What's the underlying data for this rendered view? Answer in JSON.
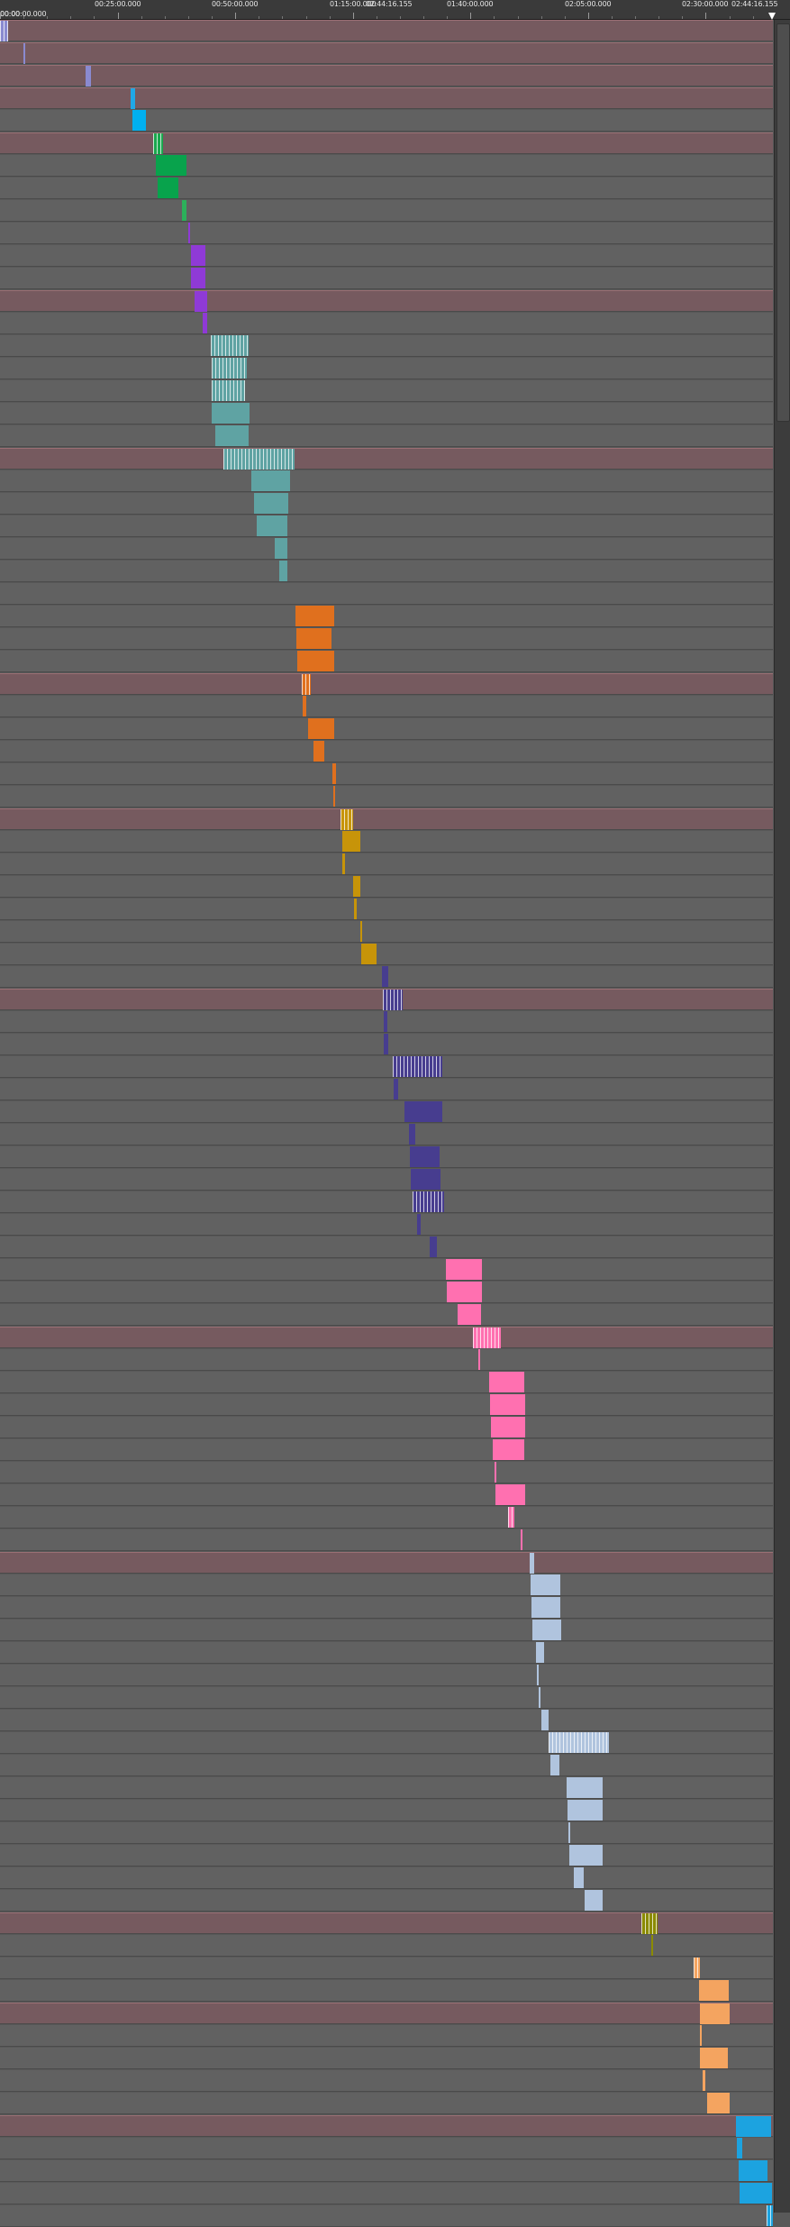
{
  "ruler": {
    "labels": [
      {
        "text": "00:00:00.000",
        "t": 0
      },
      {
        "text": "00:25:00.000",
        "t": 1500
      },
      {
        "text": "00:50:00.000",
        "t": 3000
      },
      {
        "text": "01:15:00.000",
        "t": 4500
      },
      {
        "text": "01:40:00.000",
        "t": 6000
      },
      {
        "text": "02:05:00.000",
        "t": 7500
      },
      {
        "text": "02:30:00.000",
        "t": 9000
      }
    ],
    "start_label": "00:00",
    "playhead_label": "02:44:16.155",
    "end_label": "02:44:16.155",
    "total_seconds": 9856
  },
  "colors": {
    "group_track": "#765a5f",
    "track": "#616161",
    "background": "#595959"
  },
  "tracks": [
    {
      "group": true,
      "clips": [
        {
          "s": 0,
          "e": 100,
          "c": "#8a8ad0",
          "b": true
        }
      ]
    },
    {
      "group": true,
      "clips": [
        {
          "s": 300,
          "e": 305,
          "c": "#8a8ad0"
        }
      ]
    },
    {
      "group": true,
      "clips": [
        {
          "s": 1090,
          "e": 1160,
          "c": "#8a8ad0"
        }
      ]
    },
    {
      "group": true,
      "clips": [
        {
          "s": 1660,
          "e": 1720,
          "c": "#1fa8e6"
        }
      ]
    },
    {
      "group": false,
      "clips": [
        {
          "s": 1690,
          "e": 1860,
          "c": "#00b0f0"
        }
      ]
    },
    {
      "group": true,
      "clips": [
        {
          "s": 1950,
          "e": 2080,
          "c": "#1aa84e",
          "b": true
        }
      ]
    },
    {
      "group": false,
      "clips": [
        {
          "s": 1990,
          "e": 2380,
          "c": "#08a34c"
        }
      ]
    },
    {
      "group": false,
      "clips": [
        {
          "s": 2010,
          "e": 2280,
          "c": "#08a34c"
        }
      ]
    },
    {
      "group": false,
      "clips": [
        {
          "s": 2320,
          "e": 2380,
          "c": "#2cb05a"
        }
      ]
    },
    {
      "group": false,
      "clips": [
        {
          "s": 2400,
          "e": 2420,
          "c": "#8f3ad6"
        }
      ]
    },
    {
      "group": false,
      "clips": [
        {
          "s": 2430,
          "e": 2620,
          "c": "#8f3ad6"
        }
      ]
    },
    {
      "group": false,
      "clips": [
        {
          "s": 2440,
          "e": 2620,
          "c": "#8f3ad6"
        }
      ]
    },
    {
      "group": true,
      "clips": [
        {
          "s": 2480,
          "e": 2640,
          "c": "#8f3ad6"
        }
      ]
    },
    {
      "group": false,
      "clips": [
        {
          "s": 2580,
          "e": 2640,
          "c": "#8f3ad6"
        }
      ]
    },
    {
      "group": false,
      "clips": [
        {
          "s": 2690,
          "e": 3170,
          "c": "#5fa3a3",
          "b": true
        }
      ]
    },
    {
      "group": false,
      "clips": [
        {
          "s": 2700,
          "e": 3150,
          "c": "#5fa3a3",
          "b": true
        }
      ]
    },
    {
      "group": false,
      "clips": [
        {
          "s": 2700,
          "e": 3130,
          "c": "#5fa3a3",
          "b": true
        }
      ]
    },
    {
      "group": false,
      "clips": [
        {
          "s": 2700,
          "e": 3180,
          "c": "#5fa3a3"
        }
      ]
    },
    {
      "group": false,
      "clips": [
        {
          "s": 2750,
          "e": 3170,
          "c": "#5fa3a3"
        }
      ]
    },
    {
      "group": true,
      "clips": [
        {
          "s": 2850,
          "e": 3760,
          "c": "#5fa3a3",
          "b": true
        }
      ]
    },
    {
      "group": false,
      "clips": [
        {
          "s": 3210,
          "e": 3700,
          "c": "#5fa3a3"
        }
      ]
    },
    {
      "group": false,
      "clips": [
        {
          "s": 3240,
          "e": 3680,
          "c": "#5fa3a3"
        }
      ]
    },
    {
      "group": false,
      "clips": [
        {
          "s": 3270,
          "e": 3670,
          "c": "#5fa3a3"
        }
      ]
    },
    {
      "group": false,
      "clips": [
        {
          "s": 3500,
          "e": 3670,
          "c": "#5fa3a3"
        }
      ]
    },
    {
      "group": false,
      "clips": [
        {
          "s": 3560,
          "e": 3670,
          "c": "#5fa3a3"
        }
      ]
    },
    {
      "group": false,
      "clips": []
    },
    {
      "group": false,
      "clips": [
        {
          "s": 3770,
          "e": 4260,
          "c": "#e0701e"
        }
      ]
    },
    {
      "group": false,
      "clips": [
        {
          "s": 3780,
          "e": 4230,
          "c": "#e0701e"
        }
      ]
    },
    {
      "group": false,
      "clips": [
        {
          "s": 3790,
          "e": 4260,
          "c": "#e0701e"
        }
      ]
    },
    {
      "group": true,
      "clips": [
        {
          "s": 3850,
          "e": 3960,
          "c": "#e0701e",
          "b": true
        }
      ]
    },
    {
      "group": false,
      "clips": [
        {
          "s": 3860,
          "e": 3900,
          "c": "#e0701e"
        }
      ]
    },
    {
      "group": false,
      "clips": [
        {
          "s": 3930,
          "e": 4260,
          "c": "#e0701e"
        }
      ]
    },
    {
      "group": false,
      "clips": [
        {
          "s": 4000,
          "e": 4140,
          "c": "#e0701e"
        }
      ]
    },
    {
      "group": false,
      "clips": [
        {
          "s": 4240,
          "e": 4290,
          "c": "#e0701e"
        }
      ]
    },
    {
      "group": false,
      "clips": [
        {
          "s": 4250,
          "e": 4260,
          "c": "#e0701e"
        }
      ]
    },
    {
      "group": true,
      "clips": [
        {
          "s": 4340,
          "e": 4500,
          "c": "#c79409",
          "b": true
        }
      ]
    },
    {
      "group": false,
      "clips": [
        {
          "s": 4370,
          "e": 4600,
          "c": "#c79409"
        }
      ]
    },
    {
      "group": false,
      "clips": [
        {
          "s": 4370,
          "e": 4400,
          "c": "#c79409"
        }
      ]
    },
    {
      "group": false,
      "clips": [
        {
          "s": 4500,
          "e": 4600,
          "c": "#c79409"
        }
      ]
    },
    {
      "group": false,
      "clips": [
        {
          "s": 4510,
          "e": 4550,
          "c": "#c79409"
        }
      ]
    },
    {
      "group": false,
      "clips": [
        {
          "s": 4600,
          "e": 4610,
          "c": "#c79409"
        }
      ]
    },
    {
      "group": false,
      "clips": [
        {
          "s": 4610,
          "e": 4800,
          "c": "#c79409"
        }
      ]
    },
    {
      "group": false,
      "clips": [
        {
          "s": 4870,
          "e": 4950,
          "c": "#473d8f"
        }
      ]
    },
    {
      "group": true,
      "clips": [
        {
          "s": 4880,
          "e": 5130,
          "c": "#473d8f",
          "b": true
        }
      ]
    },
    {
      "group": false,
      "clips": [
        {
          "s": 4890,
          "e": 4940,
          "c": "#473d8f"
        }
      ]
    },
    {
      "group": false,
      "clips": [
        {
          "s": 4890,
          "e": 4950,
          "c": "#473d8f"
        }
      ]
    },
    {
      "group": false,
      "clips": [
        {
          "s": 5010,
          "e": 5640,
          "c": "#473d8f",
          "b": true
        }
      ]
    },
    {
      "group": false,
      "clips": [
        {
          "s": 5020,
          "e": 5080,
          "c": "#473d8f"
        }
      ]
    },
    {
      "group": false,
      "clips": [
        {
          "s": 5160,
          "e": 5640,
          "c": "#473d8f"
        }
      ]
    },
    {
      "group": false,
      "clips": [
        {
          "s": 5220,
          "e": 5290,
          "c": "#473d8f"
        }
      ]
    },
    {
      "group": false,
      "clips": [
        {
          "s": 5230,
          "e": 5610,
          "c": "#473d8f"
        }
      ]
    },
    {
      "group": false,
      "clips": [
        {
          "s": 5240,
          "e": 5620,
          "c": "#473d8f"
        }
      ]
    },
    {
      "group": false,
      "clips": [
        {
          "s": 5260,
          "e": 5660,
          "c": "#473d8f",
          "b": true
        }
      ]
    },
    {
      "group": false,
      "clips": [
        {
          "s": 5320,
          "e": 5360,
          "c": "#473d8f"
        }
      ]
    },
    {
      "group": false,
      "clips": [
        {
          "s": 5480,
          "e": 5570,
          "c": "#473d8f"
        }
      ]
    },
    {
      "group": false,
      "clips": [
        {
          "s": 5690,
          "e": 6140,
          "c": "#ff70b0"
        }
      ]
    },
    {
      "group": false,
      "clips": [
        {
          "s": 5700,
          "e": 6140,
          "c": "#ff70b0"
        }
      ]
    },
    {
      "group": false,
      "clips": [
        {
          "s": 5830,
          "e": 6130,
          "c": "#ff70b0"
        }
      ]
    },
    {
      "group": true,
      "clips": [
        {
          "s": 6030,
          "e": 6390,
          "c": "#ff70b0",
          "b": true
        }
      ]
    },
    {
      "group": false,
      "clips": [
        {
          "s": 6100,
          "e": 6110,
          "c": "#ff70b0"
        }
      ]
    },
    {
      "group": false,
      "clips": [
        {
          "s": 6240,
          "e": 6690,
          "c": "#ff70b0"
        }
      ]
    },
    {
      "group": false,
      "clips": [
        {
          "s": 6250,
          "e": 6700,
          "c": "#ff70b0"
        }
      ]
    },
    {
      "group": false,
      "clips": [
        {
          "s": 6260,
          "e": 6700,
          "c": "#ff70b0"
        }
      ]
    },
    {
      "group": false,
      "clips": [
        {
          "s": 6280,
          "e": 6690,
          "c": "#ff70b0"
        }
      ]
    },
    {
      "group": false,
      "clips": [
        {
          "s": 6310,
          "e": 6320,
          "c": "#ff70b0"
        }
      ]
    },
    {
      "group": false,
      "clips": [
        {
          "s": 6320,
          "e": 6700,
          "c": "#ff70b0"
        }
      ]
    },
    {
      "group": false,
      "clips": [
        {
          "s": 6480,
          "e": 6560,
          "c": "#ff70b0",
          "b": true
        }
      ]
    },
    {
      "group": false,
      "clips": [
        {
          "s": 6640,
          "e": 6650,
          "c": "#ff70b0"
        }
      ]
    },
    {
      "group": true,
      "clips": [
        {
          "s": 6760,
          "e": 6810,
          "c": "#b0c4de"
        }
      ]
    },
    {
      "group": false,
      "clips": [
        {
          "s": 6770,
          "e": 7150,
          "c": "#b0c4de"
        }
      ]
    },
    {
      "group": false,
      "clips": [
        {
          "s": 6780,
          "e": 7150,
          "c": "#b0c4de"
        }
      ]
    },
    {
      "group": false,
      "clips": [
        {
          "s": 6790,
          "e": 7160,
          "c": "#b0c4de"
        }
      ]
    },
    {
      "group": false,
      "clips": [
        {
          "s": 6830,
          "e": 6940,
          "c": "#b0c4de"
        }
      ]
    },
    {
      "group": false,
      "clips": [
        {
          "s": 6850,
          "e": 6870,
          "c": "#b0c4de"
        }
      ]
    },
    {
      "group": false,
      "clips": [
        {
          "s": 6870,
          "e": 6890,
          "c": "#b0c4de"
        }
      ]
    },
    {
      "group": false,
      "clips": [
        {
          "s": 6900,
          "e": 6990,
          "c": "#b0c4de"
        }
      ]
    },
    {
      "group": false,
      "clips": [
        {
          "s": 6990,
          "e": 7760,
          "c": "#b0c4de",
          "b": true
        }
      ]
    },
    {
      "group": false,
      "clips": [
        {
          "s": 7020,
          "e": 7130,
          "c": "#b0c4de"
        }
      ]
    },
    {
      "group": false,
      "clips": [
        {
          "s": 7230,
          "e": 7680,
          "c": "#b0c4de"
        }
      ]
    },
    {
      "group": false,
      "clips": [
        {
          "s": 7240,
          "e": 7680,
          "c": "#b0c4de"
        }
      ]
    },
    {
      "group": false,
      "clips": [
        {
          "s": 7250,
          "e": 7270,
          "c": "#b0c4de"
        }
      ]
    },
    {
      "group": false,
      "clips": [
        {
          "s": 7260,
          "e": 7680,
          "c": "#b0c4de"
        }
      ]
    },
    {
      "group": false,
      "clips": [
        {
          "s": 7320,
          "e": 7440,
          "c": "#b0c4de"
        }
      ]
    },
    {
      "group": false,
      "clips": [
        {
          "s": 7460,
          "e": 7680,
          "c": "#b0c4de"
        }
      ]
    },
    {
      "group": true,
      "clips": [
        {
          "s": 8180,
          "e": 8380,
          "c": "#8b8b00",
          "b": true
        }
      ]
    },
    {
      "group": false,
      "clips": [
        {
          "s": 8300,
          "e": 8320,
          "c": "#8b8b00"
        }
      ]
    },
    {
      "group": false,
      "clips": [
        {
          "s": 8840,
          "e": 8930,
          "c": "#f4a460",
          "b": true
        }
      ]
    },
    {
      "group": false,
      "clips": [
        {
          "s": 8910,
          "e": 9290,
          "c": "#f4a460"
        }
      ]
    },
    {
      "group": true,
      "clips": [
        {
          "s": 8920,
          "e": 9300,
          "c": "#f4a460"
        }
      ]
    },
    {
      "group": false,
      "clips": [
        {
          "s": 8930,
          "e": 8940,
          "c": "#f4a460"
        }
      ]
    },
    {
      "group": false,
      "clips": [
        {
          "s": 8930,
          "e": 9280,
          "c": "#f4a460"
        }
      ]
    },
    {
      "group": false,
      "clips": [
        {
          "s": 8960,
          "e": 8990,
          "c": "#f4a460"
        }
      ]
    },
    {
      "group": false,
      "clips": [
        {
          "s": 9020,
          "e": 9300,
          "c": "#f4a460"
        }
      ]
    },
    {
      "group": true,
      "clips": [
        {
          "s": 9380,
          "e": 9830,
          "c": "#1ca3e0"
        }
      ]
    },
    {
      "group": false,
      "clips": [
        {
          "s": 9400,
          "e": 9470,
          "c": "#1ca3e0"
        }
      ]
    },
    {
      "group": false,
      "clips": [
        {
          "s": 9420,
          "e": 9790,
          "c": "#1ca3e0"
        }
      ]
    },
    {
      "group": false,
      "clips": [
        {
          "s": 9430,
          "e": 9850,
          "c": "#1ca3e0"
        }
      ]
    },
    {
      "group": false,
      "clips": [
        {
          "s": 9770,
          "e": 9856,
          "c": "#1ca3e0",
          "b": true
        }
      ]
    }
  ]
}
